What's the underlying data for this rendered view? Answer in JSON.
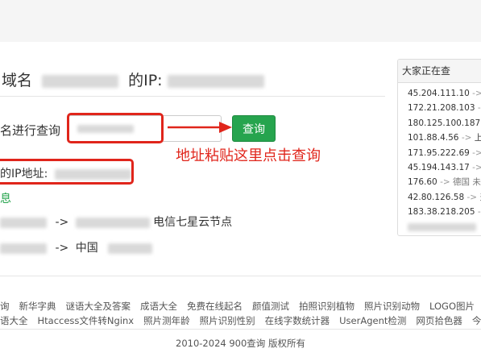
{
  "header": {
    "title_prefix": "域名",
    "title_mid": "的IP:"
  },
  "query": {
    "label": "名进行查询",
    "button_label": "查询",
    "annotation": "地址粘贴这里点击查询"
  },
  "result": {
    "ip_label": "的IP地址:",
    "green_fragment": "息",
    "row1_arrow": "->",
    "row1_text": "电信七星云节点",
    "row2_arrow": "->",
    "row2_text": "中国"
  },
  "sidebar": {
    "title": "大家正在查",
    "items": [
      {
        "ip": "45.204.111.10",
        "arrow": "->",
        "loc": "香"
      },
      {
        "ip": "172.21.208.103",
        "arrow": "->",
        "loc": ""
      },
      {
        "ip": "180.125.100.187",
        "arrow": "-",
        "loc": ""
      },
      {
        "ip": "101.88.4.56",
        "arrow": "->",
        "loc": "上"
      },
      {
        "ip": "171.95.222.69",
        "arrow": "->",
        "loc": ""
      },
      {
        "ip": "45.194.143.17",
        "arrow": "->",
        "loc": ""
      },
      {
        "ip": "176.60",
        "arrow": "->",
        "loc": "德国 未"
      },
      {
        "ip": "42.80.126.58",
        "arrow": "->",
        "loc": "天"
      },
      {
        "ip": "183.38.218.205",
        "arrow": "->",
        "loc": ""
      }
    ]
  },
  "footer": {
    "links_row1": [
      "询",
      "新华字典",
      "谜语大全及答案",
      "成语大全",
      "免费在线起名",
      "颜值测试",
      "拍照识别植物",
      "照片识别动物",
      "LOGO图片"
    ],
    "links_row2": [
      "语大全",
      "Htaccess文件转Nginx",
      "照片测年龄",
      "照片识别性别",
      "在线字数统计器",
      "UserAgent检测",
      "网页拾色器",
      "今日"
    ],
    "copyright": "2010-2024 900查询 版权所有"
  }
}
